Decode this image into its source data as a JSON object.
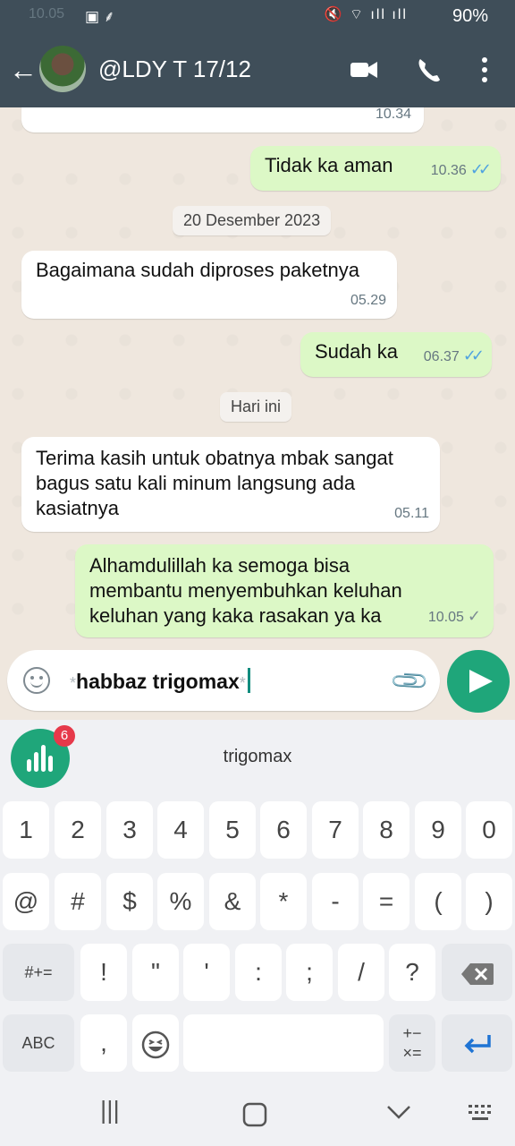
{
  "status": {
    "time": "10.05",
    "battery": "90%"
  },
  "header": {
    "contact_name": "@LDY T 17/12"
  },
  "chat": {
    "messages": [
      {
        "dir": "in",
        "text": "",
        "time": "10.34"
      },
      {
        "dir": "out",
        "text": "Tidak ka aman",
        "time": "10.36"
      },
      {
        "dir": "chip",
        "text": "20 Desember 2023"
      },
      {
        "dir": "in",
        "text": "Bagaimana sudah diproses paketnya",
        "time": "05.29"
      },
      {
        "dir": "out",
        "text": "Sudah ka",
        "time": "06.37"
      },
      {
        "dir": "chip",
        "text": "Hari ini"
      },
      {
        "dir": "in",
        "text": "Terima kasih untuk obatnya mbak sangat bagus satu kali minum langsung ada kasiatnya",
        "time": "05.11"
      },
      {
        "dir": "out",
        "text": "Alhamdulillah ka semoga bisa membantu menyembuhkan keluhan keluhan  yang kaka rasakan ya ka",
        "time": "10.05"
      }
    ]
  },
  "composer": {
    "value": "habbaz trigomax"
  },
  "keyboard": {
    "badge_count": "6",
    "suggestion": "trigomax",
    "row1": [
      "1",
      "2",
      "3",
      "4",
      "5",
      "6",
      "7",
      "8",
      "9",
      "0"
    ],
    "row2": [
      "@",
      "#",
      "$",
      "%",
      "&",
      "*",
      "-",
      "=",
      "(",
      ")"
    ],
    "row3": [
      "#+=",
      "!",
      "\"",
      "'",
      ":",
      ";",
      "/",
      "?"
    ],
    "row4": [
      "ABC",
      ","
    ]
  }
}
